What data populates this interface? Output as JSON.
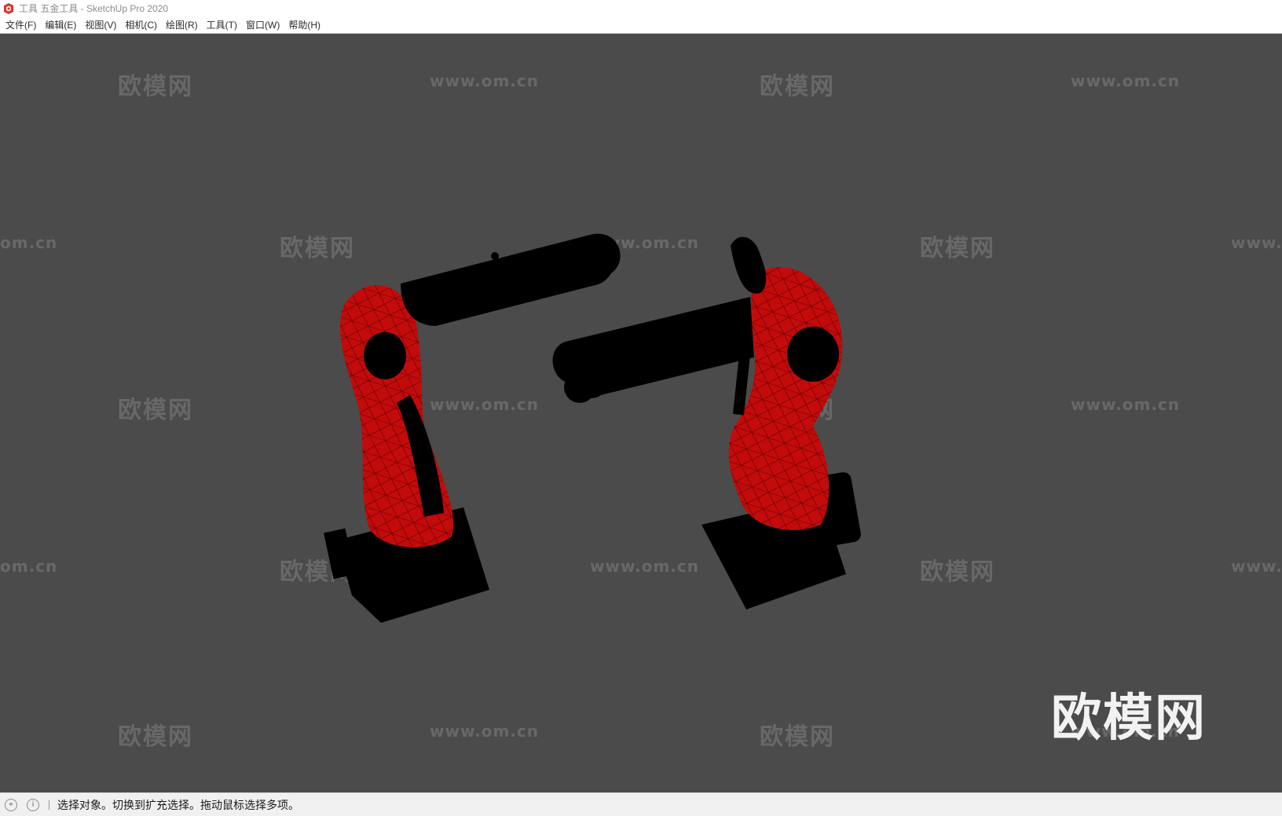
{
  "window": {
    "title": "工具 五金工具 - SketchUp Pro 2020",
    "app_icon": "sketchup-logo-icon"
  },
  "menubar": {
    "items": [
      {
        "label": "文件(F)"
      },
      {
        "label": "编辑(E)"
      },
      {
        "label": "视图(V)"
      },
      {
        "label": "相机(C)"
      },
      {
        "label": "绘图(R)"
      },
      {
        "label": "工具(T)"
      },
      {
        "label": "窗口(W)"
      },
      {
        "label": "帮助(H)"
      }
    ]
  },
  "viewport": {
    "background": "#4b4b4b",
    "model_colors": {
      "body": "#c30b0b",
      "arm": "#000000"
    },
    "watermark": {
      "brand": "欧模网",
      "url": "www.om.cn",
      "url_partial_left": "om.cn",
      "url_partial_right": "www."
    }
  },
  "statusbar": {
    "geo_icon": "geo-location-icon",
    "info_icon": "info-icon",
    "message": "选择对象。切换到扩充选择。拖动鼠标选择多项。"
  }
}
